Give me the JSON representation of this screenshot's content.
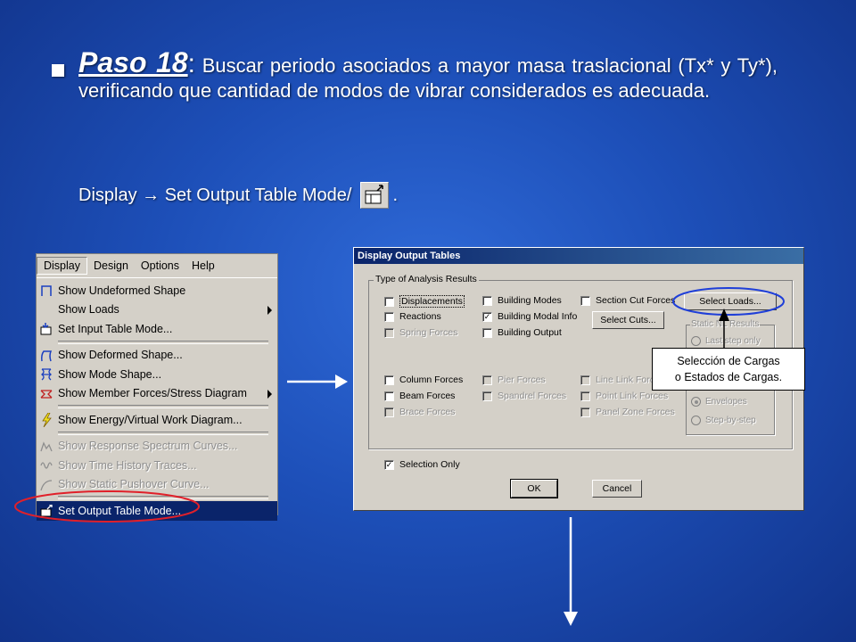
{
  "slide": {
    "step_label": "Paso 18",
    "colon": ":",
    "body_text": " Buscar periodo asociados a mayor masa traslacional (Tx* y Ty*), verificando que cantidad de modos de vibrar considerados es adecuada.",
    "display_path": "Display → Set Output Table Mode/",
    "display_suffix": "."
  },
  "menu": {
    "bar": [
      "Display",
      "Design",
      "Options",
      "Help"
    ],
    "items": [
      {
        "label": "Show Undeformed Shape",
        "icon": "undeformed-shape-icon"
      },
      {
        "label": "Show Loads",
        "icon": "none",
        "submenu": true
      },
      {
        "label": "Set Input Table Mode...",
        "icon": "input-table-icon"
      },
      {
        "label": "Show  Deformed Shape...",
        "icon": "deformed-shape-icon"
      },
      {
        "label": "Show  Mode Shape...",
        "icon": "mode-shape-icon"
      },
      {
        "label": "Show Member Forces/Stress Diagram",
        "icon": "member-forces-icon",
        "submenu": true
      },
      {
        "label": "Show Energy/Virtual Work Diagram...",
        "icon": "energy-icon"
      },
      {
        "label": "Show Response Spectrum Curves...",
        "icon": "response-spectrum-icon",
        "disabled": true
      },
      {
        "label": "Show Time History Traces...",
        "icon": "time-history-icon",
        "disabled": true
      },
      {
        "label": "Show Static Pushover Curve...",
        "icon": "pushover-icon",
        "disabled": true
      },
      {
        "label": "Set Output Table Mode...",
        "icon": "output-table-icon",
        "selected": true
      }
    ]
  },
  "dialog": {
    "title": "Display Output Tables",
    "group_title": "Type of Analysis Results",
    "col1": [
      {
        "label": "Displacements",
        "checked": false,
        "disabled": false
      },
      {
        "label": "Reactions",
        "checked": false,
        "disabled": false
      },
      {
        "label": "Spring Forces",
        "checked": false,
        "disabled": true
      },
      {
        "label": "Column Forces",
        "checked": false,
        "disabled": false
      },
      {
        "label": "Beam Forces",
        "checked": false,
        "disabled": false
      },
      {
        "label": "Brace Forces",
        "checked": false,
        "disabled": true
      }
    ],
    "col2": [
      {
        "label": "Building Modes",
        "checked": false,
        "disabled": false
      },
      {
        "label": "Building Modal Info",
        "checked": true,
        "disabled": false
      },
      {
        "label": "Building Output",
        "checked": false,
        "disabled": false
      },
      {
        "label": "Pier Forces",
        "checked": false,
        "disabled": true
      },
      {
        "label": "Spandrel Forces",
        "checked": false,
        "disabled": true
      }
    ],
    "col3": [
      {
        "label": "Section Cut Forces",
        "checked": false,
        "disabled": false
      },
      {
        "label": "Line Link Forces",
        "checked": false,
        "disabled": true
      },
      {
        "label": "Point Link Forces",
        "checked": false,
        "disabled": true
      },
      {
        "label": "Panel Zone Forces",
        "checked": false,
        "disabled": true
      }
    ],
    "select_loads": "Select Loads...",
    "select_cuts": "Select Cuts...",
    "static_nl_title": "Static NL Results",
    "static_nl_options": [
      {
        "label": "Last step only",
        "on": false
      },
      {
        "label": "Envelopes",
        "on": true
      },
      {
        "label": "Step-by-step",
        "on": false
      }
    ],
    "selection_only": "Selection Only",
    "ok": "OK",
    "cancel": "Cancel"
  },
  "callout": {
    "line1": "Selección de Cargas",
    "line2": "o Estados de Cargas."
  },
  "colors": {
    "highlight_blue": "#1f3fd8",
    "highlight_red": "#e0202a"
  }
}
